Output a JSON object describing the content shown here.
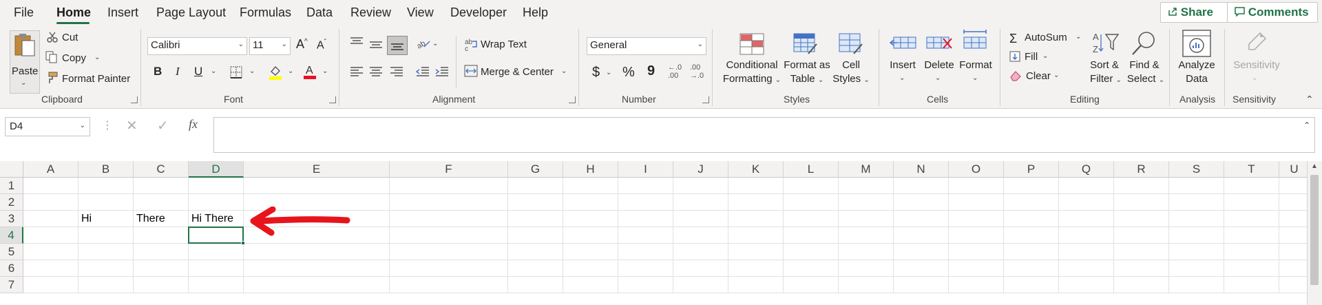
{
  "menu": {
    "tabs": [
      "File",
      "Home",
      "Insert",
      "Page Layout",
      "Formulas",
      "Data",
      "Review",
      "View",
      "Developer",
      "Help"
    ],
    "active": "Home",
    "share": "Share",
    "comments": "Comments"
  },
  "ribbon": {
    "clipboard": {
      "paste": "Paste",
      "cut": "Cut",
      "copy": "Copy",
      "format_painter": "Format Painter",
      "label": "Clipboard"
    },
    "font": {
      "name": "Calibri",
      "size": "11",
      "bold": "B",
      "italic": "I",
      "underline": "U",
      "label": "Font"
    },
    "alignment": {
      "wrap_text": "Wrap Text",
      "merge_center": "Merge & Center",
      "label": "Alignment"
    },
    "number": {
      "format": "General",
      "currency": "$",
      "percent": "%",
      "comma": "9",
      "inc_decimal": "←.0 .00",
      "dec_decimal": ".00 →.0",
      "label": "Number"
    },
    "styles": {
      "conditional_l1": "Conditional",
      "conditional_l2": "Formatting",
      "format_table_l1": "Format as",
      "format_table_l2": "Table",
      "cell_styles_l1": "Cell",
      "cell_styles_l2": "Styles",
      "label": "Styles"
    },
    "cells": {
      "insert": "Insert",
      "delete": "Delete",
      "format": "Format",
      "label": "Cells"
    },
    "editing": {
      "autosum": "AutoSum",
      "fill": "Fill",
      "clear": "Clear",
      "sort_l1": "Sort &",
      "sort_l2": "Filter",
      "find_l1": "Find &",
      "find_l2": "Select",
      "label": "Editing"
    },
    "analysis": {
      "analyze_l1": "Analyze",
      "analyze_l2": "Data",
      "label": "Analysis"
    },
    "sensitivity": {
      "button": "Sensitivity",
      "label": "Sensitivity"
    }
  },
  "formula_bar": {
    "name_box": "D4",
    "fx": "fx",
    "formula": ""
  },
  "grid": {
    "columns": [
      "A",
      "B",
      "C",
      "D",
      "E",
      "F",
      "G",
      "H",
      "I",
      "J",
      "K",
      "L",
      "M",
      "N",
      "O",
      "P",
      "Q",
      "R",
      "S",
      "T",
      "U"
    ],
    "rows": [
      "1",
      "2",
      "3",
      "4",
      "5",
      "6",
      "7"
    ],
    "selected_column": "D",
    "selected_row": "4",
    "cells": {
      "B3": "Hi",
      "C3": "There",
      "D3": "Hi There"
    }
  },
  "colors": {
    "accent": "#217346",
    "annotation": "#e8141b"
  }
}
